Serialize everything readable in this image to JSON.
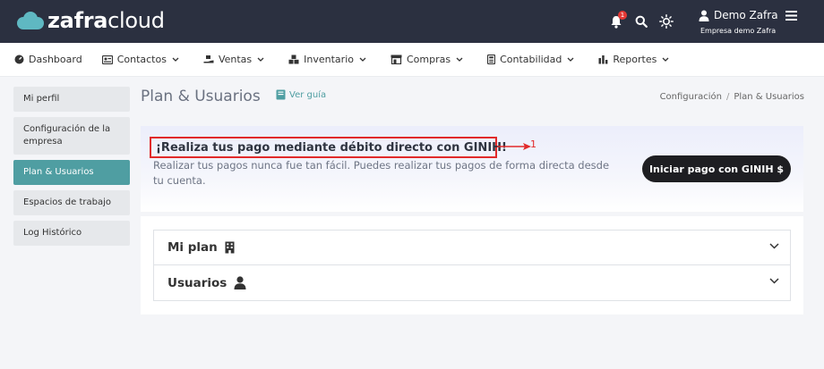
{
  "brand": {
    "name_bold": "zafra",
    "name_light": "cloud"
  },
  "topbar": {
    "notification_count": "1",
    "user_name": "Demo Zafra",
    "company": "Empresa demo Zafra"
  },
  "nav": [
    {
      "label": "Dashboard",
      "icon": "gauge-icon"
    },
    {
      "label": "Contactos",
      "icon": "contact-card-icon"
    },
    {
      "label": "Ventas",
      "icon": "hand-cart-icon"
    },
    {
      "label": "Inventario",
      "icon": "boxes-icon"
    },
    {
      "label": "Compras",
      "icon": "store-icon"
    },
    {
      "label": "Contabilidad",
      "icon": "ledger-icon"
    },
    {
      "label": "Reportes",
      "icon": "bar-chart-icon"
    }
  ],
  "sidebar": [
    {
      "label": "Mi perfil",
      "active": false
    },
    {
      "label": "Configuración de la empresa",
      "active": false
    },
    {
      "label": "Plan & Usuarios",
      "active": true
    },
    {
      "label": "Espacios de trabajo",
      "active": false
    },
    {
      "label": "Log Histórico",
      "active": false
    }
  ],
  "header": {
    "title": "Plan & Usuarios",
    "guide_label": "Ver guía"
  },
  "breadcrumb": {
    "parent": "Configuración",
    "sep": "/",
    "current": "Plan & Usuarios"
  },
  "banner": {
    "title": "¡Realiza tus pago mediante débito directo con GINIH!",
    "annotation": "1",
    "text": "Realizar tus pagos nunca fue tan fácil. Puedes realizar tus pagos de forma directa desde tu cuenta.",
    "cta": "Iniciar pago con GINIH $"
  },
  "panel": {
    "plan_label": "Mi plan",
    "users_label": "Usuarios"
  },
  "colors": {
    "topbar": "#2b3040",
    "accent": "#4f9ea2",
    "annotation": "#e12a2a",
    "cta": "#1e1e22"
  }
}
